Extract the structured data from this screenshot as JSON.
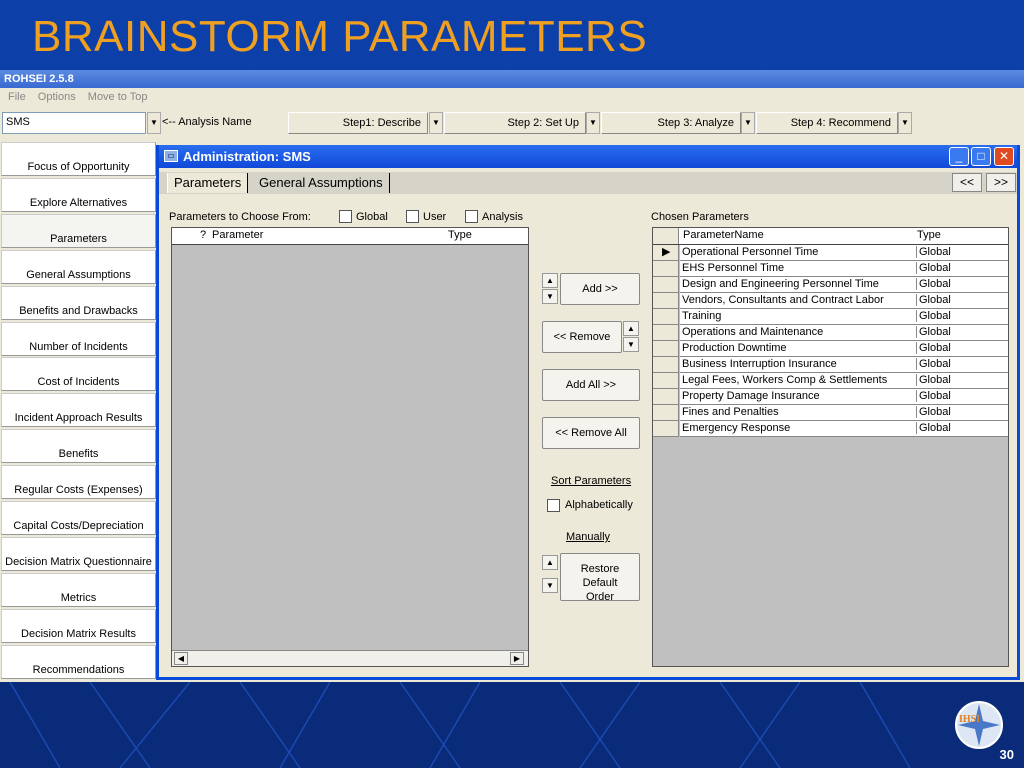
{
  "slide": {
    "title": "BRAINSTORM PARAMETERS",
    "page_number": "30",
    "logo_text": "IHSI"
  },
  "app": {
    "title": "ROHSEI 2.5.8",
    "menu": [
      "File",
      "Options",
      "Move to Top"
    ],
    "analysis_value": "SMS",
    "analysis_label": "<-- Analysis Name",
    "steps": [
      "Step1: Describe",
      "Step 2: Set Up",
      "Step 3: Analyze",
      "Step 4: Recommend"
    ]
  },
  "nav": [
    "Focus of Opportunity",
    "Explore Alternatives",
    "Parameters",
    "General Assumptions",
    "Benefits and Drawbacks",
    "Number of Incidents",
    "Cost of Incidents",
    "Incident Approach Results",
    "Benefits",
    "Regular Costs (Expenses)",
    "Capital Costs/Depreciation",
    "Decision Matrix Questionnaire",
    "Metrics",
    "Decision Matrix Results",
    "Recommendations"
  ],
  "dialog": {
    "title": "Administration: SMS",
    "tabs": [
      "Parameters",
      "General Assumptions"
    ],
    "prev": "<<",
    "next": ">>",
    "choose_label": "Parameters to Choose From:",
    "filters": [
      "Global",
      "User",
      "Analysis"
    ],
    "left_headers": {
      "flag": "?",
      "param": "Parameter",
      "type": "Type"
    },
    "chosen_label": "Chosen Parameters",
    "right_headers": {
      "name": "ParameterName",
      "type": "Type"
    },
    "chosen": [
      {
        "name": "Operational Personnel Time",
        "type": "Global"
      },
      {
        "name": "EHS Personnel Time",
        "type": "Global"
      },
      {
        "name": "Design and Engineering Personnel Time",
        "type": "Global"
      },
      {
        "name": "Vendors, Consultants and Contract Labor",
        "type": "Global"
      },
      {
        "name": "Training",
        "type": "Global"
      },
      {
        "name": "Operations and Maintenance",
        "type": "Global"
      },
      {
        "name": "Production Downtime",
        "type": "Global"
      },
      {
        "name": "Business Interruption Insurance",
        "type": "Global"
      },
      {
        "name": "Legal Fees, Workers Comp & Settlements",
        "type": "Global"
      },
      {
        "name": "Property Damage Insurance",
        "type": "Global"
      },
      {
        "name": "Fines and Penalties",
        "type": "Global"
      },
      {
        "name": "Emergency Response",
        "type": "Global"
      }
    ],
    "buttons": {
      "add": "Add >>",
      "remove": "<< Remove",
      "add_all": "Add All >>",
      "remove_all": "<< Remove All",
      "sort_title": "Sort Parameters",
      "alpha": "Alphabetically",
      "manually": "Manually",
      "restore": "Restore Default Order"
    }
  }
}
